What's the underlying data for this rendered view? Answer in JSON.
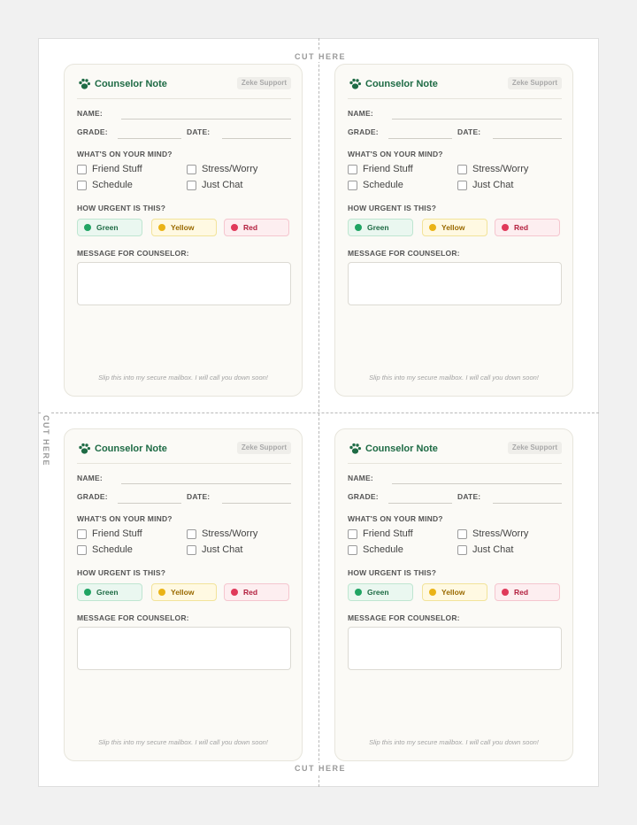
{
  "cut_label": "CUT HERE",
  "colors": {
    "title": "#1e6b45",
    "green_bg": "#eaf7f0",
    "green_border": "#bfe6d1",
    "green_dot": "#1fa463",
    "green_text": "#1e6b45",
    "yellow_bg": "#fff9e2",
    "yellow_border": "#f2e39a",
    "yellow_dot": "#eab316",
    "yellow_text": "#9a6a00",
    "red_bg": "#fdeef0",
    "red_border": "#f5c6cf",
    "red_dot": "#e0395a",
    "red_text": "#b3203f"
  },
  "card": {
    "title": "Counselor Note",
    "logo_icon": "paw-icon",
    "brand": "Zeke Support",
    "name_label": "NAME:",
    "grade_label": "GRADE:",
    "date_label": "DATE:",
    "mind_label": "WHAT'S ON YOUR MIND?",
    "topics": [
      "Friend Stuff",
      "Stress/Worry",
      "Schedule",
      "Just Chat"
    ],
    "urgency_label": "HOW URGENT IS THIS?",
    "urgency": [
      "Green",
      "Yellow",
      "Red"
    ],
    "message_label": "MESSAGE FOR COUNSELOR:",
    "footer": "Slip this into my secure mailbox. I will call you down soon!"
  }
}
